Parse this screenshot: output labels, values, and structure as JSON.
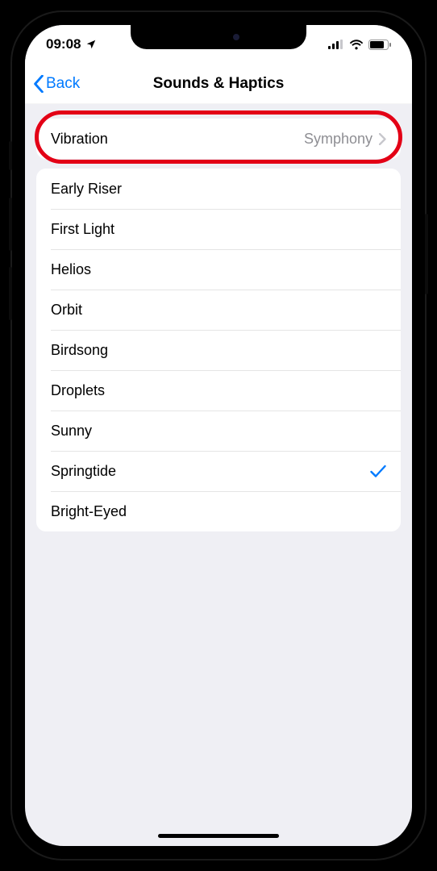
{
  "status": {
    "time": "09:08"
  },
  "nav": {
    "back": "Back",
    "title": "Sounds & Haptics"
  },
  "vibrationRow": {
    "label": "Vibration",
    "value": "Symphony"
  },
  "sounds": [
    {
      "label": "Early Riser",
      "selected": false
    },
    {
      "label": "First Light",
      "selected": false
    },
    {
      "label": "Helios",
      "selected": false
    },
    {
      "label": "Orbit",
      "selected": false
    },
    {
      "label": "Birdsong",
      "selected": false
    },
    {
      "label": "Droplets",
      "selected": false
    },
    {
      "label": "Sunny",
      "selected": false
    },
    {
      "label": "Springtide",
      "selected": true
    },
    {
      "label": "Bright-Eyed",
      "selected": false
    }
  ],
  "colors": {
    "accent": "#007aff",
    "highlight": "#e30016",
    "background": "#efeff4",
    "secondaryLabel": "#8e8e93"
  }
}
